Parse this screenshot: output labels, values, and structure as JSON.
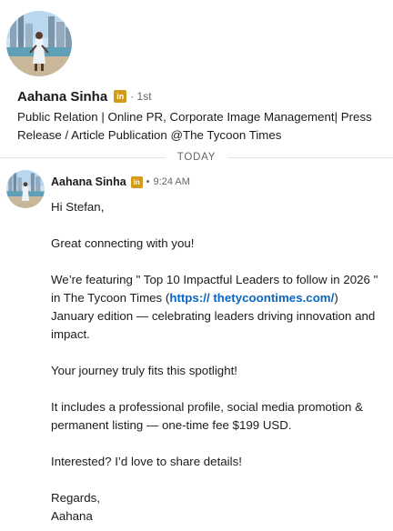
{
  "profile": {
    "name": "Aahana Sinha",
    "badge_icon": "linkedin-premium-icon",
    "badge_text": "in",
    "degree": "· 1st",
    "headline": "Public Relation | Online PR, Corporate Image Management| Press Release / Article Publication @The Tycoon Times"
  },
  "divider": {
    "label": "TODAY"
  },
  "message": {
    "sender": "Aahana Sinha",
    "badge_text": "in",
    "separator": "•",
    "time": "9:24 AM",
    "greeting": "Hi Stefan,",
    "line1": "Great connecting with you!",
    "p3_before": "We’re featuring \" Top 10 Impactful Leaders to follow in 2026 \" in The Tycoon Times (",
    "p3_link": "https:// thetycoontimes.com/",
    "p3_after": ") January edition — celebrating leaders driving innovation and impact.",
    "line4": "Your journey truly fits this spotlight!",
    "line5": "It includes a professional profile, social media promotion & permanent listing — one-time fee $199 USD.",
    "line6": "Interested? I’d love to share details!",
    "closing": "Regards,",
    "signature": "Aahana"
  },
  "colors": {
    "link": "#0a66c2",
    "badge": "#d49a1b",
    "muted": "#666666"
  }
}
